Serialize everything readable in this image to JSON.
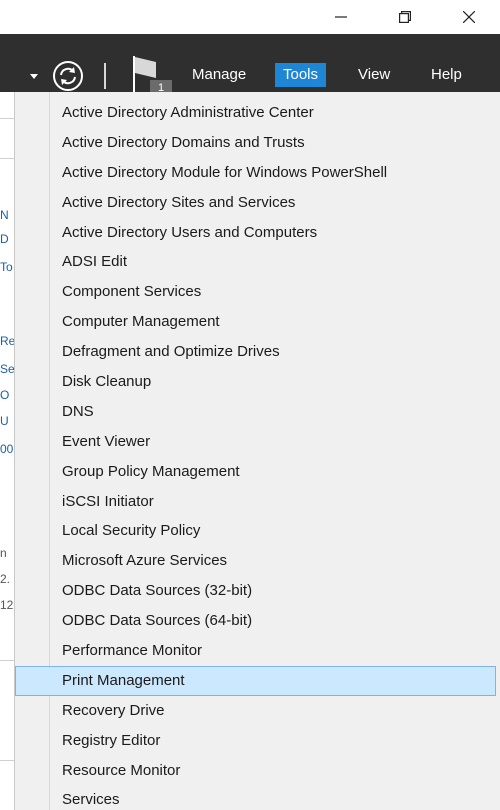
{
  "window_controls": {
    "minimize": "minimize-icon",
    "maximize": "restore-icon",
    "close": "close-icon"
  },
  "toolbar": {
    "refresh_icon": "refresh-icon",
    "flag_icon": "notification-flag-icon",
    "notification_count": "1"
  },
  "menu": {
    "manage": "Manage",
    "tools": "Tools",
    "view": "View",
    "help": "Help"
  },
  "colors": {
    "menubar": "#2f2f2f",
    "tools_active": "#1f86d6",
    "hover_bg": "#cce8ff",
    "hover_border": "#7eb4ea"
  },
  "tools_menu": {
    "items": [
      "Active Directory Administrative Center",
      "Active Directory Domains and Trusts",
      "Active Directory Module for Windows PowerShell",
      "Active Directory Sites and Services",
      "Active Directory Users and Computers",
      "ADSI Edit",
      "Component Services",
      "Computer Management",
      "Defragment and Optimize Drives",
      "Disk Cleanup",
      "DNS",
      "Event Viewer",
      "Group Policy Management",
      "iSCSI Initiator",
      "Local Security Policy",
      "Microsoft Azure Services",
      "ODBC Data Sources (32-bit)",
      "ODBC Data Sources (64-bit)",
      "Performance Monitor",
      "Print Management",
      "Recovery Drive",
      "Registry Editor",
      "Resource Monitor",
      "Services"
    ],
    "highlighted": "Print Management"
  },
  "background_fragments": [
    "N",
    "D",
    "To",
    "Re",
    "Se",
    "O",
    "U",
    "00",
    "n",
    "2.",
    "12"
  ]
}
